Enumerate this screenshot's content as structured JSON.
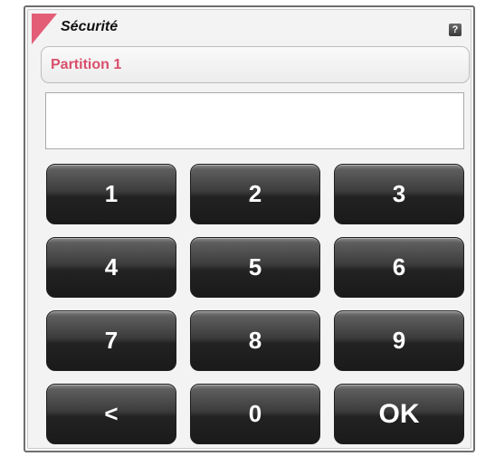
{
  "header": {
    "title": "Sécurité",
    "help_label": "?"
  },
  "partition": {
    "label": "Partition 1"
  },
  "display": {
    "value": ""
  },
  "keypad": {
    "keys": [
      "1",
      "2",
      "3",
      "4",
      "5",
      "6",
      "7",
      "8",
      "9",
      "<",
      "0",
      "OK"
    ]
  },
  "colors": {
    "accent": "#e35d76",
    "partition_text": "#d94f6b",
    "key_dark": "#1a1a1a"
  }
}
